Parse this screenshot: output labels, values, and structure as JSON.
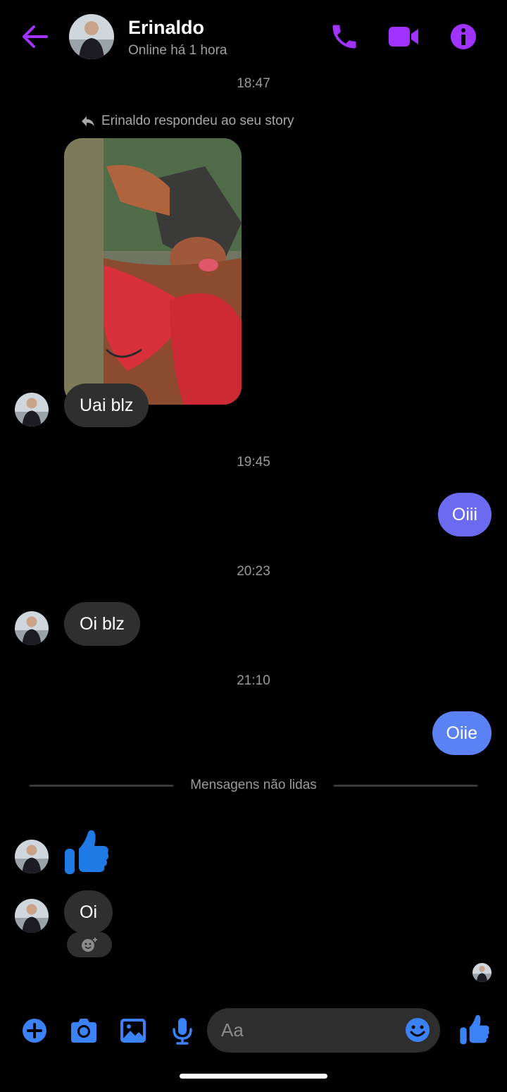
{
  "header": {
    "name": "Erinaldo",
    "status": "Online há 1 hora",
    "icons": [
      "back-arrow-icon",
      "phone-icon",
      "video-icon",
      "info-icon"
    ],
    "accent": "#a033ff"
  },
  "conversation": {
    "time_1": "18:47",
    "reply_note": "Erinaldo respondeu ao seu story",
    "msg_1": "Uai blz",
    "time_2": "19:45",
    "msg_2": "Oiii",
    "time_3": "20:23",
    "msg_3": "Oi blz",
    "time_4": "21:10",
    "msg_4": "Oiie",
    "unread_divider": "Mensagens não lidas",
    "msg_5_emoji": "thumbs-up-icon",
    "msg_6": "Oi"
  },
  "composer": {
    "placeholder": "Aa",
    "icons": [
      "plus-icon",
      "camera-icon",
      "gallery-icon",
      "mic-icon",
      "emoji-icon",
      "like-icon"
    ],
    "accent": "#3b82f6"
  },
  "colors": {
    "incoming_bubble": "#2f2f2f",
    "outgoing_bubble": "#6b6bf2",
    "background": "#000000"
  }
}
